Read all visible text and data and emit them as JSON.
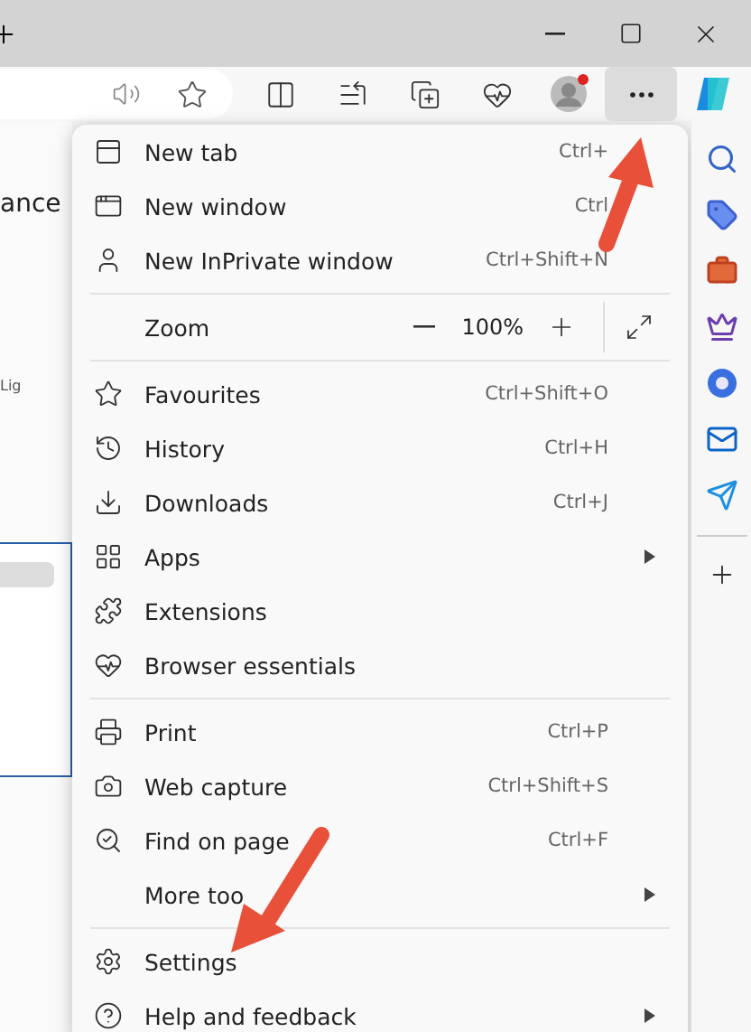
{
  "page": {
    "heading_fragment": "ance",
    "label_fragment": "Lig"
  },
  "menu": {
    "items": [
      {
        "kind": "item",
        "label": "New tab",
        "shortcut": "Ctrl+",
        "submenu": false
      },
      {
        "kind": "item",
        "label": "New window",
        "shortcut": "Ctrl",
        "submenu": false
      },
      {
        "kind": "item",
        "label": "New InPrivate window",
        "shortcut": "Ctrl+Shift+N",
        "submenu": false
      },
      {
        "kind": "divider"
      },
      {
        "kind": "zoom",
        "label": "Zoom",
        "value": "100%"
      },
      {
        "kind": "divider"
      },
      {
        "kind": "item",
        "label": "Favourites",
        "shortcut": "Ctrl+Shift+O",
        "submenu": false
      },
      {
        "kind": "item",
        "label": "History",
        "shortcut": "Ctrl+H",
        "submenu": false
      },
      {
        "kind": "item",
        "label": "Downloads",
        "shortcut": "Ctrl+J",
        "submenu": false
      },
      {
        "kind": "item",
        "label": "Apps",
        "submenu": true
      },
      {
        "kind": "item",
        "label": "Extensions",
        "submenu": false
      },
      {
        "kind": "item",
        "label": "Browser essentials",
        "submenu": false
      },
      {
        "kind": "divider"
      },
      {
        "kind": "item",
        "label": "Print",
        "shortcut": "Ctrl+P",
        "submenu": false
      },
      {
        "kind": "item",
        "label": "Web capture",
        "shortcut": "Ctrl+Shift+S",
        "submenu": false
      },
      {
        "kind": "item",
        "label": "Find on page",
        "shortcut": "Ctrl+F",
        "submenu": false
      },
      {
        "kind": "item",
        "label": "More too",
        "submenu": true
      },
      {
        "kind": "divider"
      },
      {
        "kind": "item",
        "label": "Settings",
        "submenu": false
      },
      {
        "kind": "item",
        "label": "Help and feedback",
        "submenu": true
      }
    ]
  }
}
